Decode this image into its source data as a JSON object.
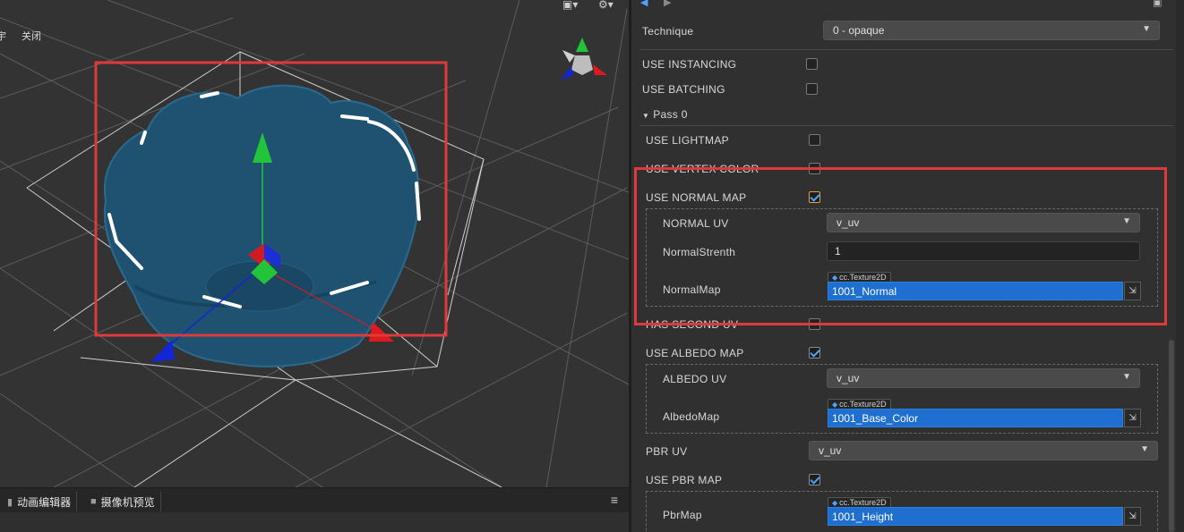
{
  "scene": {
    "toolbar_partial_char": "宇",
    "close_label": "关闭",
    "camera_icon": "camera-dropdown-icon",
    "gear_icon": "gear-dropdown-icon",
    "camera_glyph": "▣▾",
    "gear_glyph": "⚙▾"
  },
  "bottom_tabs": [
    {
      "label": "动画编辑器",
      "icon": "animation-editor-icon"
    },
    {
      "label": "摄像机预览",
      "icon": "camera-preview-icon"
    }
  ],
  "bottom_menu_glyph": "≡",
  "inspector": {
    "technique_label": "Technique",
    "technique_value": "0 - opaque",
    "use_instancing_label": "USE  INSTANCING",
    "use_batching_label": "USE  BATCHING",
    "pass_label": "Pass 0",
    "use_lightmap_label": "USE  LIGHTMAP",
    "use_vertex_color_label": "USE  VERTEX  COLOR",
    "use_normal_map_label": "USE  NORMAL  MAP",
    "normal_uv_label": "NORMAL  UV",
    "normal_uv_value": "v_uv",
    "normal_strength_label": "NormalStrenth",
    "normal_strength_value": "1",
    "normal_map_label": "NormalMap",
    "normal_map_type": "cc.Texture2D",
    "normal_map_value": "1001_Normal",
    "has_second_uv_label": "HAS  SECOND  UV",
    "use_albedo_map_label": "USE  ALBEDO  MAP",
    "albedo_uv_label": "ALBEDO  UV",
    "albedo_uv_value": "v_uv",
    "albedo_map_label": "AlbedoMap",
    "albedo_map_type": "cc.Texture2D",
    "albedo_map_value": "1001_Base_Color",
    "pbr_uv_label": "PBR  UV",
    "pbr_uv_value": "v_uv",
    "use_pbr_map_label": "USE  PBR  MAP",
    "pbr_map_label": "PbrMap",
    "pbr_map_type": "cc.Texture2D",
    "pbr_map_value": "1001_Height",
    "asset_pick_glyph": "⇲",
    "select_arrow": "▼",
    "pass_arrow": "▼"
  },
  "state": {
    "use_instancing": false,
    "use_batching": false,
    "use_lightmap": false,
    "use_vertex_color": false,
    "use_normal_map": true,
    "has_second_uv": false,
    "use_albedo_map": true,
    "use_pbr_map": true
  },
  "colors": {
    "highlight": "#e0393b",
    "asset_field": "#1f6fd1",
    "model": "#1d4f6e",
    "gizmo_y": "#22c53a",
    "gizmo_x": "#e0191f",
    "gizmo_z": "#1326d6"
  }
}
